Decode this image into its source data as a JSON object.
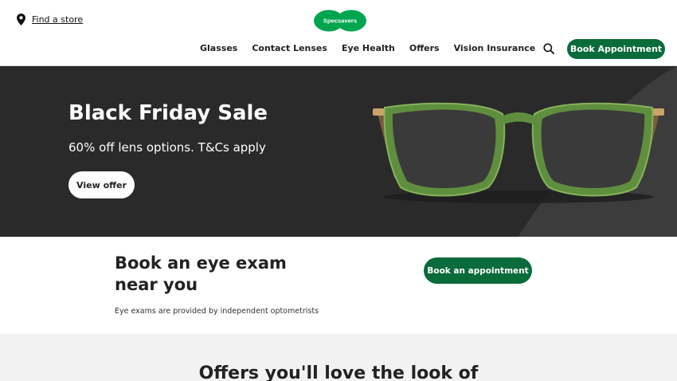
{
  "header": {
    "find_store": "Find a store",
    "logo_text": "Specsavers",
    "nav": [
      "Glasses",
      "Contact Lenses",
      "Eye Health",
      "Offers",
      "Vision Insurance"
    ],
    "book_button": "Book Appointment"
  },
  "hero": {
    "title": "Black Friday Sale",
    "subtitle": "60% off lens options. T&Cs apply",
    "cta": "View offer"
  },
  "exam": {
    "title": "Book an eye exam near you",
    "note": "Eye exams are provided by independent optometrists",
    "cta": "Book an appointment"
  },
  "offers": {
    "title": "Offers you'll love the look of"
  },
  "colors": {
    "brand_green": "#0a6b3b",
    "logo_green": "#00a54f",
    "hero_bg": "#2a2a2a",
    "offers_bg": "#f2f2f2"
  },
  "icons": {
    "find_store": "location-pin-icon",
    "search": "search-icon"
  }
}
